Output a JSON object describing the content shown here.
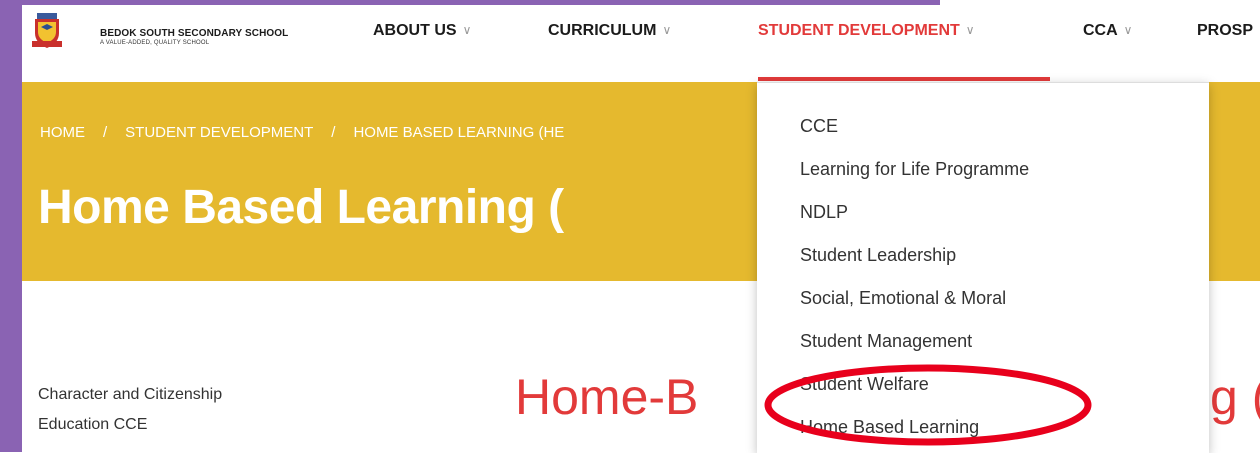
{
  "header": {
    "school_name": "BEDOK SOUTH SECONDARY SCHOOL",
    "tagline": "A VALUE-ADDED, QUALITY SCHOOL",
    "nav": [
      {
        "label": "ABOUT US"
      },
      {
        "label": "CURRICULUM"
      },
      {
        "label": "STUDENT DEVELOPMENT"
      },
      {
        "label": "CCA"
      },
      {
        "label": "PROSP"
      }
    ],
    "active_color": "#e23a3a",
    "icons": {
      "chevron": "chevron-down-icon",
      "logo": "school-crest-icon"
    }
  },
  "banner": {
    "background": "#e5b92e",
    "breadcrumb": [
      "HOME",
      "STUDENT DEVELOPMENT",
      "HOME BASED LEARNING (HE"
    ],
    "separator": "/",
    "title": "Home Based Learning ("
  },
  "sidebar": {
    "items": [
      "Character and Citizenship",
      "Education CCE"
    ]
  },
  "content": {
    "title_left": "Home-B",
    "title_right": "g (H"
  },
  "dropdown": {
    "items": [
      "CCE",
      "Learning for Life Programme",
      "NDLP",
      "Student Leadership",
      "Social, Emotional & Moral",
      "Student Management",
      "Student Welfare",
      "Home Based Learning"
    ],
    "highlighted_item": "Home Based Learning",
    "highlight_color": "#e8001c"
  }
}
